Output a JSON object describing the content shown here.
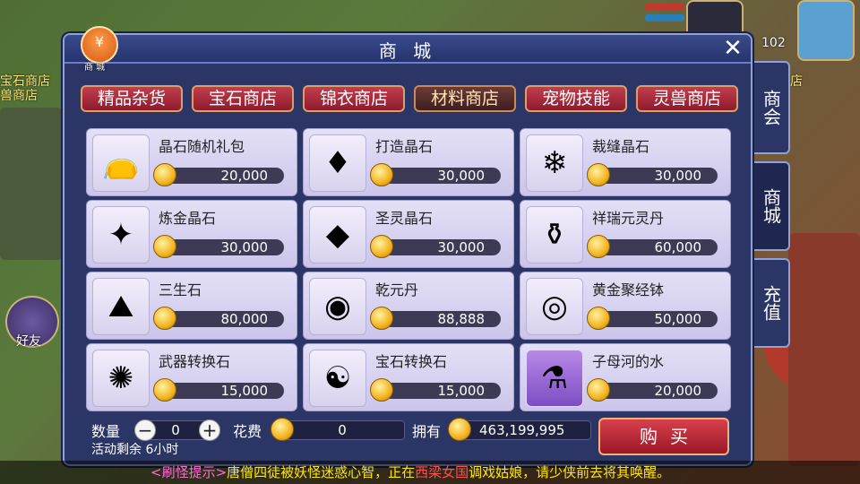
{
  "background": {
    "left_labels": [
      "宝石商店",
      "兽商店"
    ],
    "right_label": "店",
    "friend_label": "好友",
    "level": "102"
  },
  "shop": {
    "title": "商 城",
    "icon_label": "商 城",
    "close": "✕",
    "tabs": [
      "精品杂货",
      "宝石商店",
      "锦衣商店",
      "材料商店",
      "宠物技能",
      "灵兽商店"
    ],
    "active_tab": 3,
    "items": [
      {
        "name": "晶石随机礼包",
        "price": "20,000",
        "icon": "gift-bag-icon",
        "glyph": "👝"
      },
      {
        "name": "打造晶石",
        "price": "30,000",
        "icon": "red-crystal-icon",
        "glyph": "♦"
      },
      {
        "name": "裁缝晶石",
        "price": "30,000",
        "icon": "blue-crystal-icon",
        "glyph": "❄"
      },
      {
        "name": "炼金晶石",
        "price": "30,000",
        "icon": "green-crystal-icon",
        "glyph": "✦"
      },
      {
        "name": "圣灵晶石",
        "price": "30,000",
        "icon": "purple-crystal-icon",
        "glyph": "◆"
      },
      {
        "name": "祥瑞元灵丹",
        "price": "60,000",
        "icon": "gourd-icon",
        "glyph": "⚱"
      },
      {
        "name": "三生石",
        "price": "80,000",
        "icon": "stone-icon",
        "glyph": "⛰"
      },
      {
        "name": "乾元丹",
        "price": "88,888",
        "icon": "pill-icon",
        "glyph": "◉"
      },
      {
        "name": "黄金聚经钵",
        "price": "50,000",
        "icon": "golden-bowl-icon",
        "glyph": "◎"
      },
      {
        "name": "武器转换石",
        "price": "15,000",
        "icon": "blue-flame-icon",
        "glyph": "✺"
      },
      {
        "name": "宝石转换石",
        "price": "15,000",
        "icon": "yin-yang-icon",
        "glyph": "☯"
      },
      {
        "name": "子母河的水",
        "price": "20,000",
        "icon": "vase-icon",
        "glyph": "⚗"
      }
    ],
    "side_tabs": [
      "商会",
      "商城",
      "充值"
    ],
    "quantity_label": "数量",
    "quantity_value": "0",
    "minus": "−",
    "plus": "+",
    "cost_label": "花费",
    "cost_value": "0",
    "owned_label": "拥有",
    "owned_value": "463,199,995",
    "remain_text": "活动剩余 6小时",
    "buy_label": "购买"
  },
  "notice": {
    "tag": "<刷怪提示>",
    "text1": "唐僧四徒被妖怪迷惑心智，正在",
    "place": "西梁女国",
    "text2": "调戏姑娘，请少侠前去将其唤醒。"
  },
  "colors": {
    "panel_bg": "#2b3566",
    "tab_red": "#c23d4f",
    "item_bg": "#e4e0f6",
    "notice_yellow": "#ffe800"
  }
}
